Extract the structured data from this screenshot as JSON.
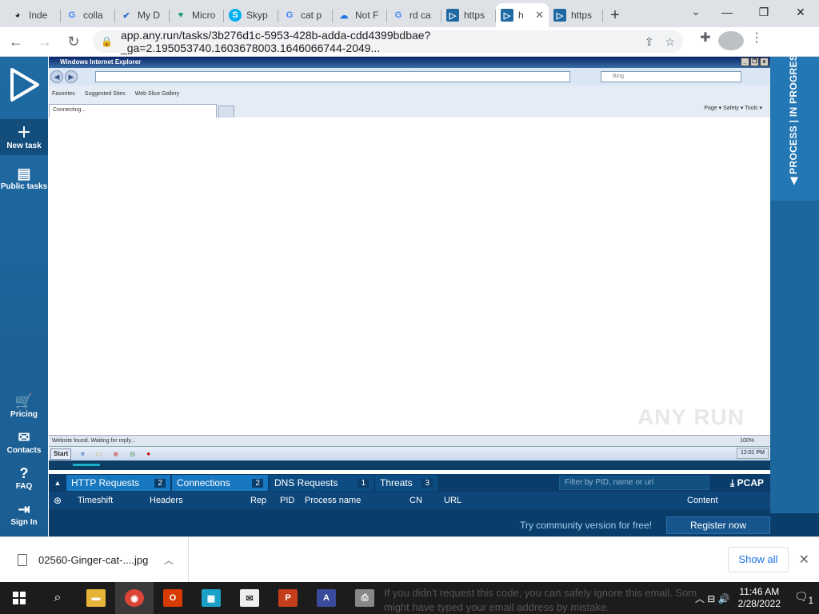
{
  "browser": {
    "tabs": [
      {
        "label": "Inde",
        "icon": "github-icon",
        "color": "#202124"
      },
      {
        "label": "colla",
        "icon": "google-icon",
        "color": "#4285f4"
      },
      {
        "label": "My D",
        "icon": "check-icon",
        "color": "#2b6cd4"
      },
      {
        "label": "Micro",
        "icon": "heart-icon",
        "color": "#1a9a6c"
      },
      {
        "label": "Skyp",
        "icon": "skype-icon",
        "color": "#00aff0"
      },
      {
        "label": "cat p",
        "icon": "google-icon",
        "color": "#4285f4"
      },
      {
        "label": "Not F",
        "icon": "cloud-icon",
        "color": "#1a73e8"
      },
      {
        "label": "rd ca",
        "icon": "google-icon",
        "color": "#4285f4"
      },
      {
        "label": "https",
        "icon": "anyrun-icon",
        "color": "#1f6aa3"
      },
      {
        "label": "h",
        "icon": "anyrun-icon",
        "color": "#1f6aa3",
        "active": true
      },
      {
        "label": "https",
        "icon": "anyrun-icon",
        "color": "#1f6aa3"
      }
    ],
    "url": "app.any.run/tasks/3b276d1c-5953-428b-adda-cdd4399bdbae?_ga=2.195053740.1603678003.1646066744-2049..."
  },
  "sidebar": {
    "new_task": "New task",
    "public_tasks": "Public tasks",
    "pricing": "Pricing",
    "contacts": "Contacts",
    "faq": "FAQ",
    "sign_in": "Sign In"
  },
  "right_strip": {
    "status": "PROCESS | IN PROGRESS"
  },
  "vm": {
    "ie_title": "Windows Internet Explorer",
    "search_placeholder": "Bing",
    "favorites": "Favorites",
    "suggested": "Suggested Sites",
    "web_slice": "Web Slice Gallery",
    "tab_label": "Connecting...",
    "cmdbar": "Page ▾   Safety ▾   Tools ▾",
    "status_text": "Website found. Waiting for reply...",
    "zoom": "100%",
    "start": "Start",
    "tray_time": "12:01 PM",
    "watermark": "ANY RUN"
  },
  "panel": {
    "tabs": [
      {
        "label": "HTTP Requests",
        "count": "2"
      },
      {
        "label": "Connections",
        "count": "2"
      },
      {
        "label": "DNS Requests",
        "count": "1"
      },
      {
        "label": "Threats",
        "count": "3"
      }
    ],
    "filter_placeholder": "Filter by PID, name or url",
    "pcap": "PCAP",
    "columns": [
      "Timeshift",
      "Headers",
      "Rep",
      "PID",
      "Process name",
      "CN",
      "URL",
      "Content"
    ]
  },
  "footer": {
    "try_text": "Try community version for free!",
    "register": "Register now"
  },
  "download": {
    "filename": "02560-Ginger-cat-....jpg",
    "show_all": "Show all"
  },
  "taskbar": {
    "time": "11:46 AM",
    "date": "2/28/2022",
    "notif_count": "1",
    "bg_text_line1": "If you didn't request this code, you can safely ignore this email. Som",
    "bg_text_line2": "might have typed your email address by mistake."
  }
}
